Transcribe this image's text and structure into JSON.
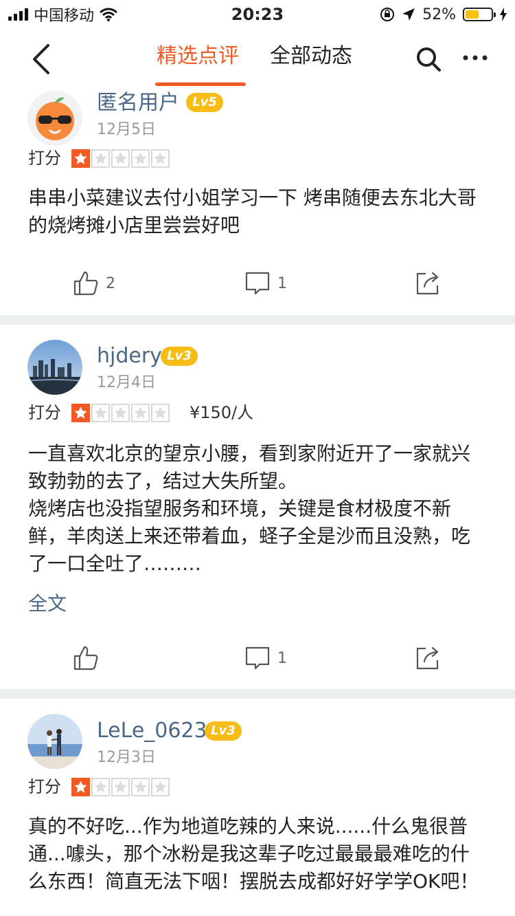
{
  "status_bar": {
    "carrier": "中国移动",
    "time": "20:23",
    "battery_text": "52%",
    "battery_level": 0.52
  },
  "nav": {
    "tab_featured": "精选点评",
    "tab_all": "全部动态",
    "accent_color": "#f25a23"
  },
  "reviews": [
    {
      "user": "匿名用户",
      "level": "Lv5",
      "date": "12月5日",
      "score_label": "打分",
      "rating": 1,
      "max_rating": 5,
      "text": [
        "串串小菜建议去付小姐学习一下 烤串随便去东北大哥的烧烤摊小店里尝尝好吧"
      ],
      "likes": "2",
      "comments": "1"
    },
    {
      "user": "hjdery",
      "level": "Lv3",
      "date": "12月4日",
      "score_label": "打分",
      "rating": 1,
      "max_rating": 5,
      "price": "¥150/人",
      "text": [
        "一直喜欢北京的望京小腰，看到家附近开了一家就兴致勃勃的去了，结过大失所望。",
        "烧烤店也没指望服务和环境，关键是食材极度不新鲜，羊肉送上来还带着血，蛏子全是沙而且没熟，吃了一口全吐了………"
      ],
      "full_text_link": "全文",
      "comments": "1"
    },
    {
      "user": "LeLe_0623",
      "level": "Lv3",
      "date": "12月3日",
      "score_label": "打分",
      "rating": 1,
      "max_rating": 5,
      "text": [
        "真的不好吃...作为地道吃辣的人来说......什么鬼很普通...噱头，那个冰粉是我这辈子吃过最最最难吃的什么东西！简直无法下咽！摆脱去成都好好学学OK吧！"
      ]
    }
  ]
}
